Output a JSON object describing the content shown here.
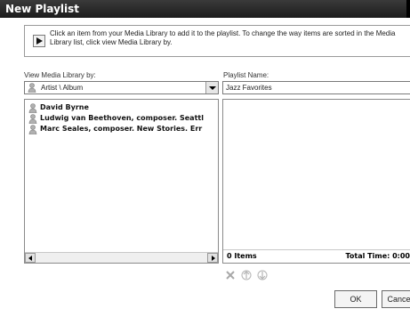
{
  "window": {
    "title": "New Playlist"
  },
  "info": {
    "text": "Click an item from your Media Library to add it to the playlist. To change the way items are sorted in the Media Library list, click view Media Library by."
  },
  "library": {
    "label": "View Media Library by:",
    "view_value": "Artist \\ Album",
    "items": [
      {
        "label": "David Byrne"
      },
      {
        "label": "Ludwig van Beethoven, composer. Seattl"
      },
      {
        "label": "Marc Seales, composer. New Stories. Err"
      }
    ]
  },
  "playlist": {
    "name_label": "Playlist Name:",
    "name_value": "Jazz Favorites",
    "items_count": "0 Items",
    "total_time": "Total Time: 0:00"
  },
  "buttons": {
    "ok": "OK",
    "cancel": "Cancel"
  },
  "icons": {
    "delete": "delete-x-icon",
    "move_up": "move-up-icon",
    "move_down": "move-down-icon",
    "user": "user-icon",
    "info": "play-arrow-icon"
  }
}
